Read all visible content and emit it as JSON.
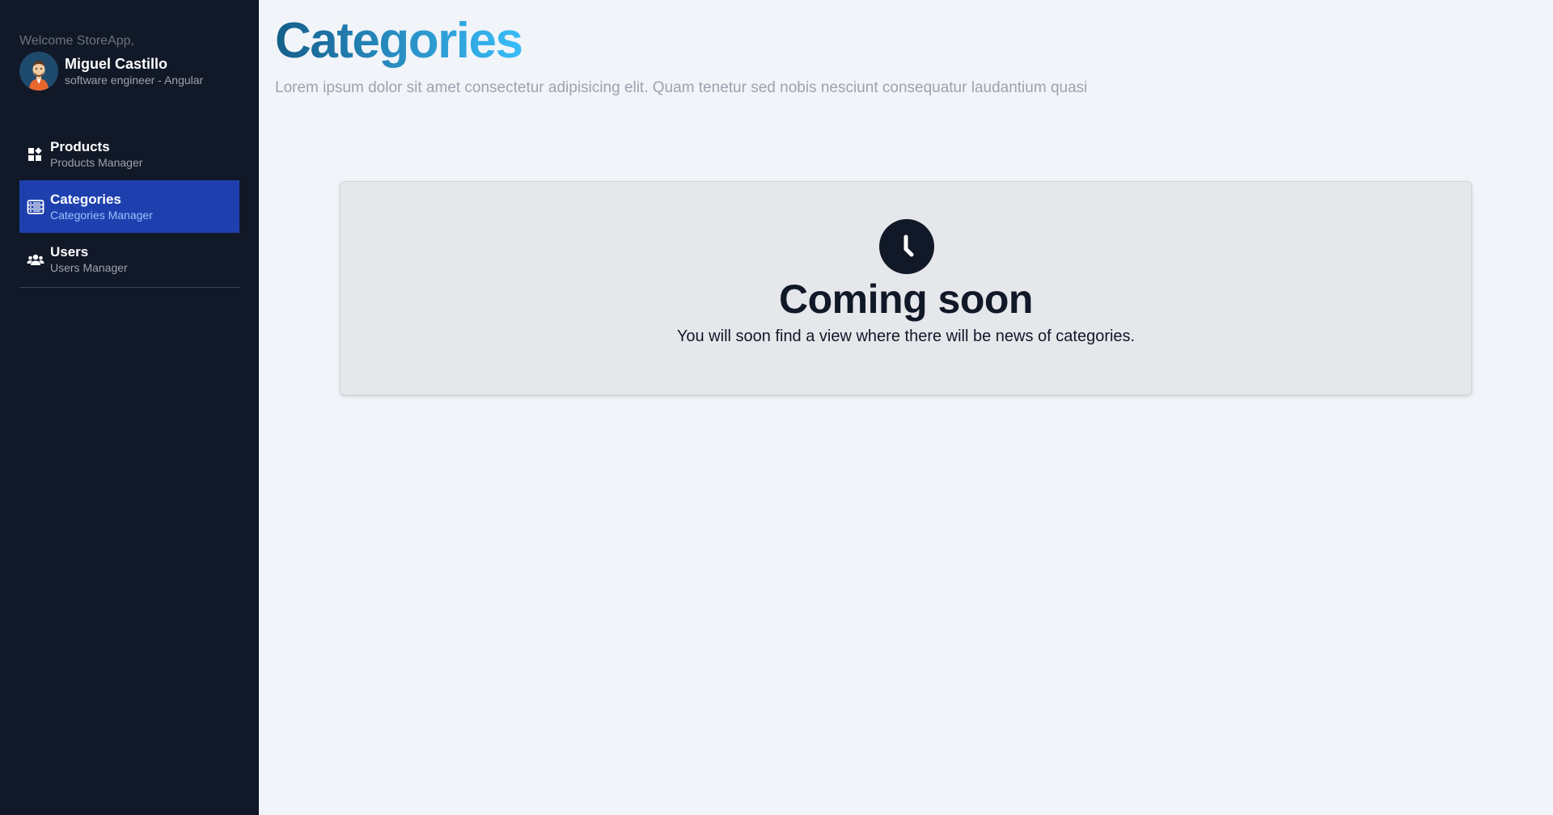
{
  "sidebar": {
    "welcome": "Welcome StoreApp,",
    "user": {
      "name": "Miguel Castillo",
      "role": "software engineer - Angular"
    },
    "items": [
      {
        "title": "Products",
        "subtitle": "Products Manager",
        "icon": "grid-icon",
        "active": false
      },
      {
        "title": "Categories",
        "subtitle": "Categories Manager",
        "icon": "list-icon",
        "active": true
      },
      {
        "title": "Users",
        "subtitle": "Users Manager",
        "icon": "users-icon",
        "active": false
      }
    ]
  },
  "main": {
    "title": "Categories",
    "subtitle": "Lorem ipsum dolor sit amet consectetur adipisicing elit. Quam tenetur sed nobis nesciunt consequatur laudantium quasi",
    "card": {
      "icon": "clock-icon",
      "title": "Coming soon",
      "text": "You will soon find a view where there will be news of categories."
    }
  },
  "colors": {
    "sidebar_bg": "#111827",
    "active_item": "#1e40af",
    "page_bg": "#f1f4f9",
    "title_gradient_start": "#155e8a",
    "title_gradient_end": "#38bdf8"
  }
}
